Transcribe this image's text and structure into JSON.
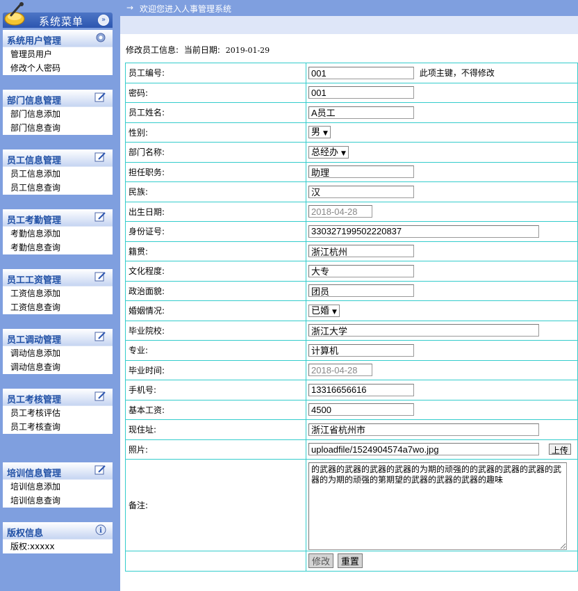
{
  "sidebar": {
    "title": "系统菜单",
    "groups": [
      {
        "title": "系统用户管理",
        "items": [
          "管理员用户",
          "修改个人密码"
        ]
      },
      {
        "title": "部门信息管理",
        "items": [
          "部门信息添加",
          "部门信息查询"
        ]
      },
      {
        "title": "员工信息管理",
        "items": [
          "员工信息添加",
          "员工信息查询"
        ]
      },
      {
        "title": "员工考勤管理",
        "items": [
          "考勤信息添加",
          "考勤信息查询"
        ]
      },
      {
        "title": "员工工资管理",
        "items": [
          "工资信息添加",
          "工资信息查询"
        ]
      },
      {
        "title": "员工调动管理",
        "items": [
          "调动信息添加",
          "调动信息查询"
        ]
      },
      {
        "title": "员工考核管理",
        "items": [
          "员工考核评估",
          "员工考核查询"
        ]
      },
      {
        "title": "培训信息管理",
        "items": [
          "培训信息添加",
          "培训信息查询"
        ]
      },
      {
        "title": "版权信息",
        "items": [
          "版权:xxxxx"
        ]
      }
    ]
  },
  "topbar": {
    "arrow": "→",
    "welcome": "欢迎您进入人事管理系统"
  },
  "header": {
    "label": "修改员工信息:",
    "date_label": "当前日期:",
    "date": "2019-01-29"
  },
  "form": {
    "emp_id": {
      "label": "员工编号:",
      "value": "001",
      "note": "此项主键，不得修改"
    },
    "password": {
      "label": "密码:",
      "value": "001"
    },
    "name": {
      "label": "员工姓名:",
      "value": "A员工"
    },
    "gender": {
      "label": "性别:",
      "value": "男"
    },
    "dept": {
      "label": "部门名称:",
      "value": "总经办"
    },
    "position": {
      "label": "担任职务:",
      "value": "助理"
    },
    "ethnicity": {
      "label": "民族:",
      "value": "汉"
    },
    "birth": {
      "label": "出生日期:",
      "value": "2018-04-28"
    },
    "idcard": {
      "label": "身份证号:",
      "value": "330327199502220837"
    },
    "native": {
      "label": "籍贯:",
      "value": "浙江杭州"
    },
    "education": {
      "label": "文化程度:",
      "value": "大专"
    },
    "politics": {
      "label": "政治面貌:",
      "value": "团员"
    },
    "marriage": {
      "label": "婚姻情况:",
      "value": "已婚"
    },
    "school": {
      "label": "毕业院校:",
      "value": "浙江大学"
    },
    "major": {
      "label": "专业:",
      "value": "计算机"
    },
    "grad_time": {
      "label": "毕业时间:",
      "value": "2018-04-28"
    },
    "phone": {
      "label": "手机号:",
      "value": "13316656616"
    },
    "salary": {
      "label": "基本工资:",
      "value": "4500"
    },
    "address": {
      "label": "现住址:",
      "value": "浙江省杭州市"
    },
    "photo": {
      "label": "照片:",
      "value": "uploadfile/1524904574a7wo.jpg",
      "upload_label": "上传"
    },
    "remark": {
      "label": "备注:",
      "value": "的武器的武器的武器的武器的为期的顽强的的武器的武器的武器的武器的为期的顽强的第期望的武器的武器的武器的趣味"
    },
    "submit_label": "修改",
    "reset_label": "重置"
  },
  "colors": {
    "sidebar_bg": "#7f9fdf",
    "border": "#33cccc",
    "group_title": "#1f4fa5"
  }
}
